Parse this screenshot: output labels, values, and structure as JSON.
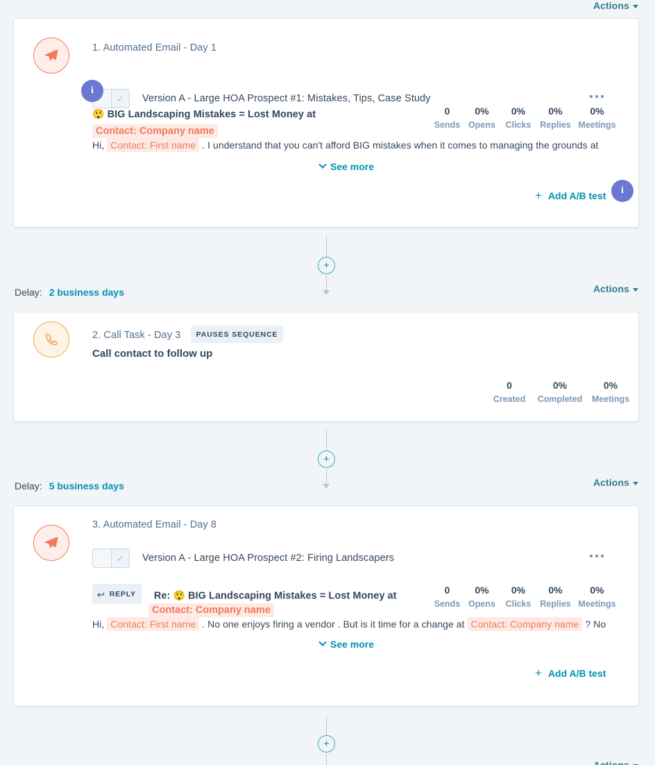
{
  "page": {
    "background": "#f2f5f8",
    "accent_teal": "#0091ae",
    "accent_orange": "#f2795b",
    "accent_purple": "#6a78d1",
    "text_dark": "#33475b",
    "text_muted": "#7c98b6"
  },
  "top_actions": {
    "label": "Actions"
  },
  "steps": [
    {
      "id": "step-1",
      "type": "email",
      "icon": "paper-plane-icon",
      "title": "1. Automated Email - Day 1",
      "version_label": "Version A - Large HOA Prospect #1: Mistakes, Tips, Case Study",
      "toggle_check": "✓",
      "info_badge": "i",
      "overflow_menu": "more-options",
      "subject": {
        "emoji": "😲",
        "text": "BIG Landscaping Mistakes = Lost Money at",
        "token": "Contact: Company name"
      },
      "body": {
        "prefix": "Hi,",
        "token": "Contact: First name",
        "suffix": ". I understand that you can't afford BIG mistakes when it comes to managing the grounds at"
      },
      "see_more": "See more",
      "add_ab_test": "Add A/B test",
      "stats": [
        {
          "value": "0",
          "label": "Sends"
        },
        {
          "value": "0%",
          "label": "Opens"
        },
        {
          "value": "0%",
          "label": "Clicks"
        },
        {
          "value": "0%",
          "label": "Replies"
        },
        {
          "value": "0%",
          "label": "Meetings"
        }
      ]
    },
    {
      "id": "step-2",
      "type": "call",
      "icon": "phone-icon",
      "title": "2. Call Task - Day 3",
      "badge": "PAUSES SEQUENCE",
      "task_text": "Call contact to follow up",
      "stats": [
        {
          "value": "0",
          "label": "Created"
        },
        {
          "value": "0%",
          "label": "Completed"
        },
        {
          "value": "0%",
          "label": "Meetings"
        }
      ]
    },
    {
      "id": "step-3",
      "type": "email",
      "icon": "paper-plane-icon",
      "title": "3. Automated Email - Day 8",
      "version_label": "Version A - Large HOA Prospect #2: Firing Landscapers",
      "toggle_check": "✓",
      "overflow_menu": "more-options",
      "reply_badge": "REPLY",
      "reply_arrow": "↩",
      "subject": {
        "prefix": "Re:",
        "emoji": "😲",
        "text": "BIG Landscaping Mistakes = Lost Money at",
        "token": "Contact: Company name"
      },
      "body": {
        "prefix": "Hi,",
        "token1": "Contact: First name",
        "middle": ". No one enjoys firing a vendor . But is it time for a change at",
        "token2": "Contact: Company name",
        "suffix": "? No"
      },
      "see_more": "See more",
      "add_ab_test": "Add A/B test",
      "stats": [
        {
          "value": "0",
          "label": "Sends"
        },
        {
          "value": "0%",
          "label": "Opens"
        },
        {
          "value": "0%",
          "label": "Clicks"
        },
        {
          "value": "0%",
          "label": "Replies"
        },
        {
          "value": "0%",
          "label": "Meetings"
        }
      ]
    }
  ],
  "connectors": [
    {
      "id": "connector-1",
      "add_step": "+",
      "delay_label": "Delay:",
      "delay_value": "2 business days",
      "actions_label": "Actions"
    },
    {
      "id": "connector-2",
      "add_step": "+",
      "delay_label": "Delay:",
      "delay_value": "5 business days",
      "actions_label": "Actions"
    },
    {
      "id": "connector-3",
      "add_step": "+",
      "actions_label": "Actions"
    }
  ]
}
